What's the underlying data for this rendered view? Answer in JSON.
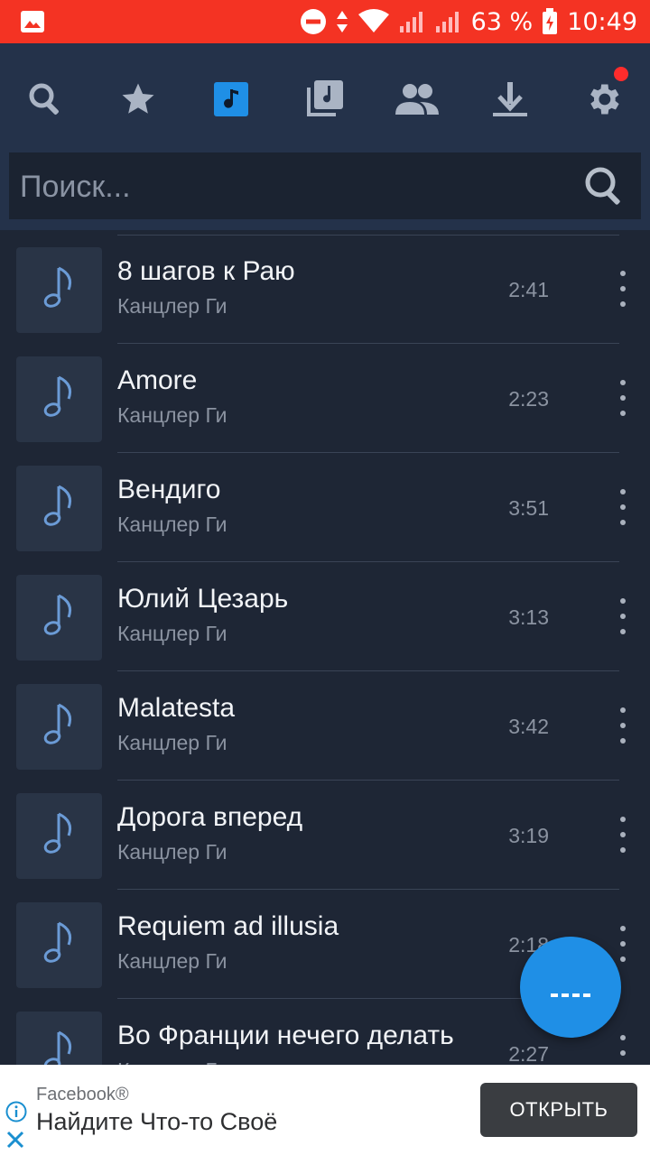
{
  "status_bar": {
    "battery": "63 %",
    "time": "10:49"
  },
  "toolbar": {
    "icons": [
      "search-icon",
      "star-icon",
      "music-note-icon",
      "music-library-icon",
      "people-icon",
      "download-icon",
      "gear-icon"
    ],
    "active_tab": "music-note-icon",
    "accent": "#1f8fe6",
    "notification_dot_color": "#ff2c2c"
  },
  "search": {
    "placeholder": "Поиск..."
  },
  "tracks": [
    {
      "title": "8 шагов к Раю",
      "artist": "Канцлер Ги",
      "duration": "2:41"
    },
    {
      "title": "Amore",
      "artist": "Канцлер Ги",
      "duration": "2:23"
    },
    {
      "title": "Вендиго",
      "artist": "Канцлер Ги",
      "duration": "3:51"
    },
    {
      "title": "Юлий Цезарь",
      "artist": "Канцлер Ги",
      "duration": "3:13"
    },
    {
      "title": "Malatesta",
      "artist": "Канцлер Ги",
      "duration": "3:42"
    },
    {
      "title": "Дорога вперед",
      "artist": "Канцлер Ги",
      "duration": "3:19"
    },
    {
      "title": "Requiem ad illusia",
      "artist": "Канцлер Ги",
      "duration": "2:18"
    },
    {
      "title": "Во Франции нечего делать",
      "artist": "Канцлер Ги",
      "duration": "2:27"
    }
  ],
  "ad": {
    "source": "Facebook®",
    "text": "Найдите Что-то Своё",
    "button": "ОТКРЫТЬ"
  },
  "colors": {
    "status_bar": "#f43323",
    "background": "#1e2635",
    "toolbar": "#24324a"
  }
}
